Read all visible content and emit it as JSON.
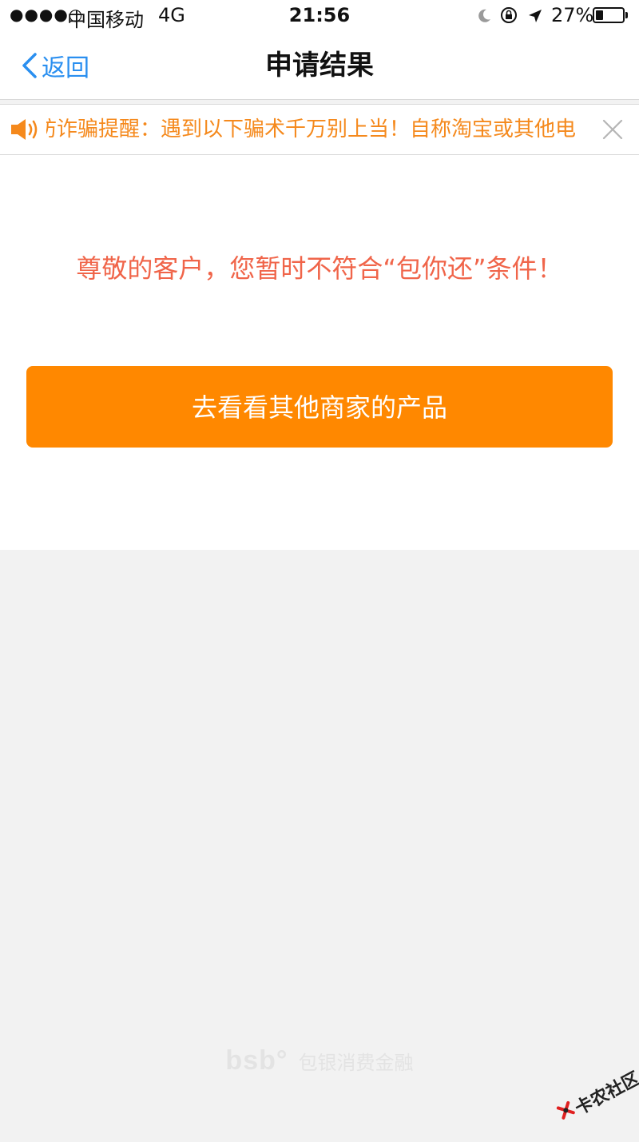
{
  "status_bar": {
    "signal": "●●●●○",
    "carrier": "中国移动",
    "network": "4G",
    "time": "21:56",
    "battery_percent": "27%",
    "battery_level": 0.27,
    "icons": [
      "moon-icon",
      "orientation-lock-icon",
      "location-arrow-icon",
      "battery-icon"
    ]
  },
  "nav": {
    "back_label": "返回",
    "title": "申请结果"
  },
  "notice": {
    "icon": "speaker-icon",
    "text": "防诈骗提醒：遇到以下骗术千万别上当！自称淘宝或其他电",
    "close_icon": "close-icon"
  },
  "result": {
    "message": "尊敬的客户，您暂时不符合“包你还”条件！",
    "button_label": "去看看其他商家的产品"
  },
  "footer": {
    "logo_mark": "bsb°",
    "logo_text": "包银消费金融"
  },
  "watermark": {
    "text": "卡农社区"
  },
  "colors": {
    "accent_orange": "#ff8800",
    "notice_orange": "#f5891c",
    "message_red": "#f0654a",
    "link_blue": "#2a8ff0",
    "page_bg": "#f2f2f2"
  }
}
